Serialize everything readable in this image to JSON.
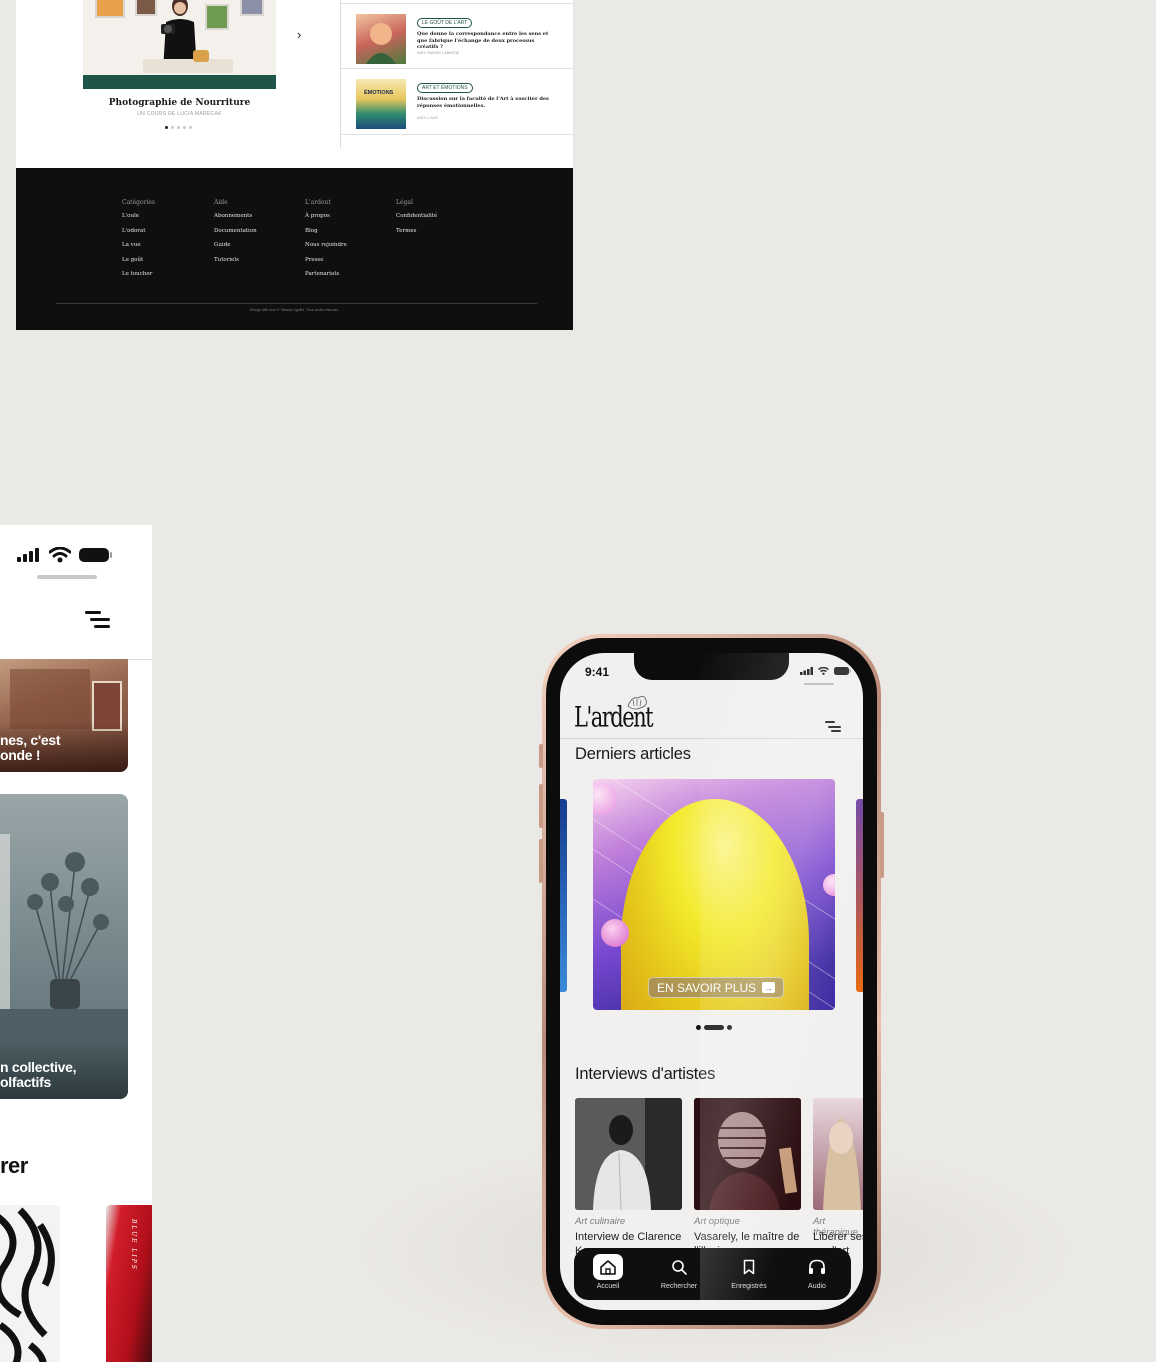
{
  "desktop": {
    "course": {
      "title": "Photographie de Nourriture",
      "subtitle": "UN COURS DE LUCIA MARECAK"
    },
    "articles": [
      {
        "tag": "LE GOÛT DE L'ART",
        "title": "Que donne la correspondance entre les sens et que fabrique l'échange de deux processus créatifs ?",
        "byline": "AVEC RADVID, LABASTIE"
      },
      {
        "tag": "ART ET ÉMOTIONS",
        "title": "Discussion sur la faculté de l'Art à susciter des réponses émotionnelles.",
        "byline": "AVEC LOUIS",
        "thumb_label": "ÉMOTIONS"
      }
    ],
    "footer": {
      "columns": [
        {
          "heading": "Catégories",
          "items": [
            "L'ouïe",
            "L'odorat",
            "La vue",
            "Le goût",
            "Le toucher"
          ]
        },
        {
          "heading": "Aide",
          "items": [
            "Abonnements",
            "Documentation",
            "Guide",
            "Tutoriels"
          ]
        },
        {
          "heading": "L'ardent",
          "items": [
            "À propos",
            "Blog",
            "Nous rejoindre",
            "Presse",
            "Partenariats"
          ]
        },
        {
          "heading": "Légal",
          "items": [
            "Confidentialité",
            "Termes"
          ]
        }
      ],
      "copyright": "Design with love © Tatiana Ugolini. Tous droits réservés."
    }
  },
  "mobile_zoom": {
    "card1_text": [
      "nes, c'est",
      "onde !"
    ],
    "card2_text": [
      "n collective,",
      "olfactifs"
    ],
    "heading": "rer",
    "book_text": "BLUE LIPS"
  },
  "phone": {
    "time": "9:41",
    "logo": "L'ardent",
    "section1": "Derniers articles",
    "hero_button": "EN SAVOIR PLUS",
    "section2": "Interviews d'artistes",
    "interviews": [
      {
        "category": "Art culinaire",
        "title": "Interview de Clarence Kenang"
      },
      {
        "category": "Art optique",
        "title": "Vasarely, le maître de l'illusion"
      },
      {
        "category": "Art thérapique",
        "title": "Libérer ses émotions par l'art"
      }
    ],
    "nav": [
      "Accueil",
      "Rechercher",
      "Enregistrés",
      "Audio"
    ]
  }
}
